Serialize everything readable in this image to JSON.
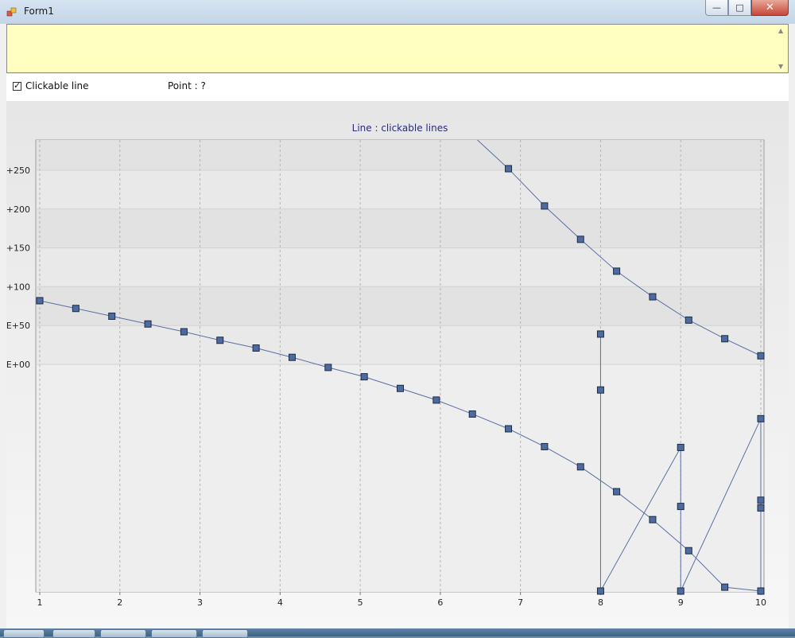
{
  "window": {
    "title": "Form1",
    "minimize_glyph": "—",
    "maximize_glyph": "□",
    "close_glyph": "✕"
  },
  "log": {
    "text": "",
    "scroll_up_glyph": "▲",
    "scroll_down_glyph": "▼"
  },
  "options": {
    "clickable_line_label": "Clickable line",
    "clickable_line_checked": true,
    "point_label": "Point : ?"
  },
  "icons": {
    "app": "form-app-icon",
    "check": "check-mark-icon"
  },
  "colors": {
    "series_line": "#5a6fa2",
    "marker_fill": "#4e6b9e",
    "marker_stroke": "#1c2a4a",
    "title": "#2a2a7a"
  },
  "chart_data": {
    "type": "line",
    "title": "Line : clickable lines",
    "xlabel": "",
    "ylabel": "",
    "xlim": [
      1,
      10
    ],
    "ylim": [
      -290,
      290
    ],
    "x_ticks": [
      1,
      2,
      3,
      4,
      5,
      6,
      7,
      8,
      9,
      10
    ],
    "x_tick_labels": [
      "1",
      "2",
      "3",
      "4",
      "5",
      "6",
      "7",
      "8",
      "9",
      "10"
    ],
    "y_ticks": [
      250,
      200,
      150,
      100,
      50,
      0
    ],
    "y_tick_labels": [
      "+250",
      "+200",
      "+150",
      "+100",
      "E+50",
      "E+00"
    ],
    "grid": true,
    "series": [
      {
        "values": [
          [
            1,
            82
          ],
          [
            1.45,
            72
          ],
          [
            1.9,
            62
          ],
          [
            2.35,
            52
          ],
          [
            2.8,
            42
          ],
          [
            3.25,
            31
          ],
          [
            3.7,
            21
          ],
          [
            4.15,
            9
          ],
          [
            4.6,
            -4
          ],
          [
            5.05,
            -16
          ],
          [
            5.5,
            -31
          ],
          [
            5.95,
            -46
          ],
          [
            6.4,
            -64
          ],
          [
            6.85,
            -83
          ],
          [
            7.3,
            -106
          ],
          [
            7.75,
            -132
          ],
          [
            8.2,
            -164
          ],
          [
            8.65,
            -200
          ],
          [
            9.1,
            -240
          ],
          [
            9.55,
            -287
          ],
          [
            10,
            -292
          ]
        ]
      },
      {
        "values": [
          [
            6.4,
            295
          ],
          [
            6.85,
            252
          ],
          [
            7.3,
            204
          ],
          [
            7.75,
            161
          ],
          [
            8.2,
            120
          ],
          [
            8.65,
            87
          ],
          [
            9.1,
            57
          ],
          [
            9.55,
            33
          ],
          [
            10,
            11
          ]
        ]
      },
      {
        "values": [
          [
            8,
            39
          ],
          [
            8,
            -33
          ],
          [
            8,
            -292
          ],
          [
            9,
            -107
          ],
          [
            9,
            -183
          ],
          [
            9,
            -292
          ],
          [
            10,
            -70
          ],
          [
            10,
            -175
          ],
          [
            10,
            -185
          ],
          [
            10,
            -292
          ]
        ]
      }
    ]
  }
}
